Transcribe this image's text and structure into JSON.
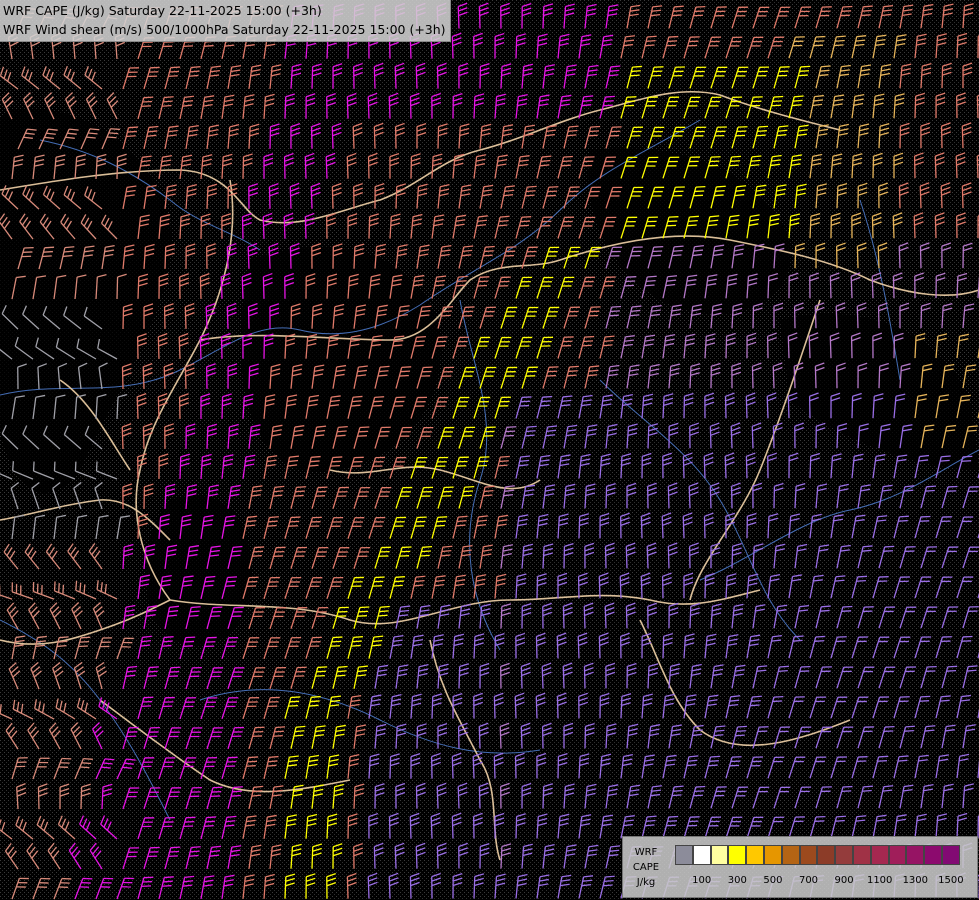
{
  "titles": {
    "line1": "WRF CAPE (J/kg) Saturday 22-11-2025 15:00 (+3h)",
    "line2": "WRF Wind shear (m/s) 500/1000hPa Saturday 22-11-2025 15:00 (+3h)"
  },
  "legend": {
    "label_line1": "WRF",
    "label_line2": "CAPE",
    "label_line3": "J/kg",
    "colors": [
      "#8c8c9a",
      "#ffffff",
      "#fffea0",
      "#ffff00",
      "#ffc800",
      "#e69600",
      "#b46414",
      "#9c4a1e",
      "#8c3c28",
      "#943c3c",
      "#a03246",
      "#a52850",
      "#a01e5a",
      "#961464",
      "#8c0a6e",
      "#820a73"
    ],
    "ticks": [
      {
        "label": "100",
        "index": 1
      },
      {
        "label": "300",
        "index": 3
      },
      {
        "label": "500",
        "index": 5
      },
      {
        "label": "700",
        "index": 7
      },
      {
        "label": "900",
        "index": 9
      },
      {
        "label": "1100",
        "index": 11
      },
      {
        "label": "1300",
        "index": 13
      },
      {
        "label": "1500",
        "index": 15
      }
    ]
  },
  "barb_colors": {
    "weak": "#a0a0a8",
    "moderate": "#d88a7a",
    "strong": "#e07a6a",
    "yellow": "#ffff00",
    "gold": "#e6b45a",
    "magenta": "#e614e6",
    "violet": "#9a6ee6",
    "purple": "#b478c8"
  },
  "map_colors": {
    "border": "#e6c8a0",
    "river": "#4a78c8",
    "terrain": "#606060"
  }
}
